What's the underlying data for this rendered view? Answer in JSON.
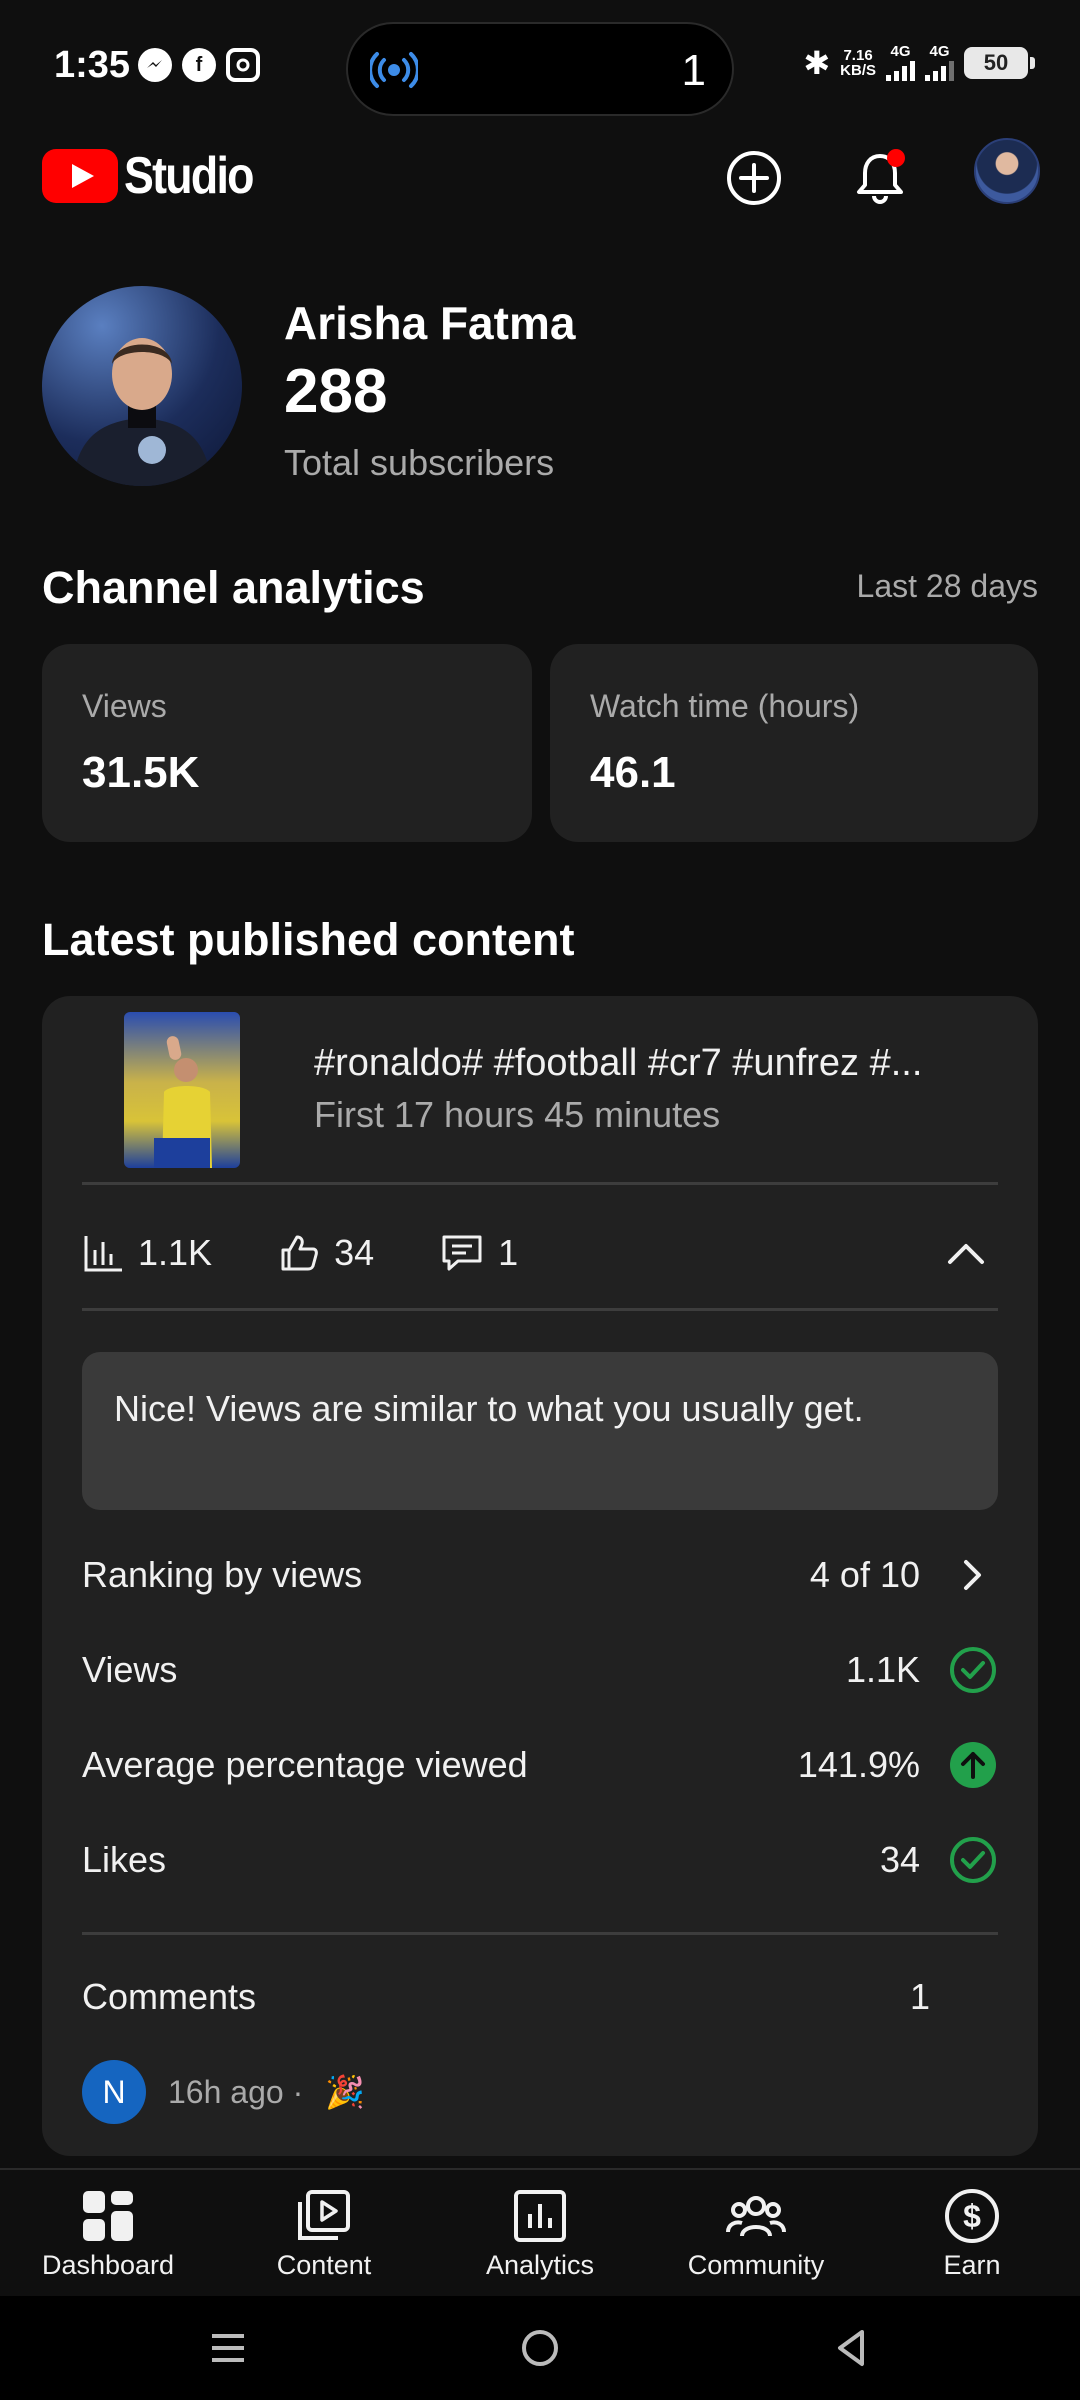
{
  "status_bar": {
    "time": "1:35",
    "island_count": "1",
    "net_speed_top": "7.16",
    "net_speed_unit": "KB/S",
    "network_1": "4G",
    "network_2": "4G",
    "battery": "50"
  },
  "header": {
    "logo_text": "Studio"
  },
  "profile": {
    "channel_name": "Arisha Fatma",
    "subscriber_count": "288",
    "subscriber_label": "Total subscribers"
  },
  "analytics": {
    "title": "Channel analytics",
    "period": "Last 28 days",
    "cards": [
      {
        "label": "Views",
        "value": "31.5K"
      },
      {
        "label": "Watch time (hours)",
        "value": "46.1"
      }
    ]
  },
  "latest": {
    "title": "Latest published content",
    "video_title": "#ronaldo# #football #cr7 #unfrez #...",
    "video_subtitle": "First 17 hours 45 minutes",
    "metrics": {
      "views": "1.1K",
      "likes": "34",
      "comments": "1"
    },
    "insight": "Nice! Views are similar to what you usually get.",
    "rows": [
      {
        "label": "Ranking by views",
        "value": "4 of 10",
        "icon": "chevron-right-icon"
      },
      {
        "label": "Views",
        "value": "1.1K",
        "icon": "check-circle-icon"
      },
      {
        "label": "Average percentage viewed",
        "value": "141.9%",
        "icon": "arrow-up-circle-icon"
      },
      {
        "label": "Likes",
        "value": "34",
        "icon": "check-circle-icon"
      }
    ],
    "comments_label": "Comments",
    "comments_count": "1",
    "comment_avatar_initial": "N",
    "comment_time": "16h ago ·",
    "comment_emoji": "🎉"
  },
  "colors": {
    "background": "#0f0f0f",
    "card": "#212121",
    "accent_red": "#ff0000",
    "success_green": "#22a04b",
    "live_blue": "#3d8ce8"
  },
  "bottom_nav": [
    {
      "label": "Dashboard",
      "icon": "dashboard-icon",
      "active": true
    },
    {
      "label": "Content",
      "icon": "content-icon",
      "active": false
    },
    {
      "label": "Analytics",
      "icon": "analytics-icon",
      "active": false
    },
    {
      "label": "Community",
      "icon": "community-icon",
      "active": false
    },
    {
      "label": "Earn",
      "icon": "earn-icon",
      "active": false
    }
  ]
}
